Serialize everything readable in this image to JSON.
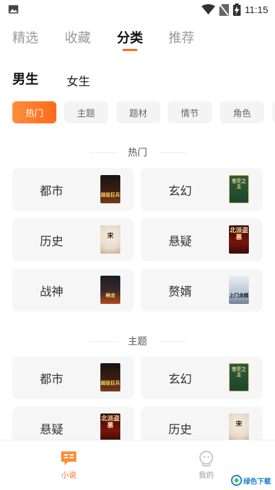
{
  "status_bar": {
    "time": "11:15"
  },
  "top_tabs": [
    "精选",
    "收藏",
    "分类",
    "推荐"
  ],
  "active_top_tab": "分类",
  "gender": {
    "male": "男生",
    "female": "女生"
  },
  "filters": [
    "热门",
    "主题",
    "题材",
    "情节",
    "角色"
  ],
  "sections": [
    {
      "title": "热门",
      "items": [
        {
          "label": "都市",
          "cover_text": "超级狂兵"
        },
        {
          "label": "玄幻",
          "cover_text": "苍茫之主"
        },
        {
          "label": "历史",
          "cover_text": "宋"
        },
        {
          "label": "悬疑",
          "cover_text": "北派盗墓"
        },
        {
          "label": "战神",
          "cover_text": "神龙"
        },
        {
          "label": "赘婿",
          "cover_text": "上门龙婿"
        }
      ]
    },
    {
      "title": "主题",
      "items": [
        {
          "label": "都市",
          "cover_text": "超级狂兵"
        },
        {
          "label": "玄幻",
          "cover_text": "苍茫之主"
        },
        {
          "label": "悬疑",
          "cover_text": "北派盗墓"
        },
        {
          "label": "历史",
          "cover_text": "宋"
        }
      ]
    }
  ],
  "bottom_nav": [
    {
      "label": "小说",
      "icon": "book-chat-icon"
    },
    {
      "label": "我的",
      "icon": "user-face-icon"
    }
  ],
  "watermark": "绿色下载",
  "colors": {
    "accent": "#ff6a1a",
    "card_bg": "#f6f6f6"
  }
}
